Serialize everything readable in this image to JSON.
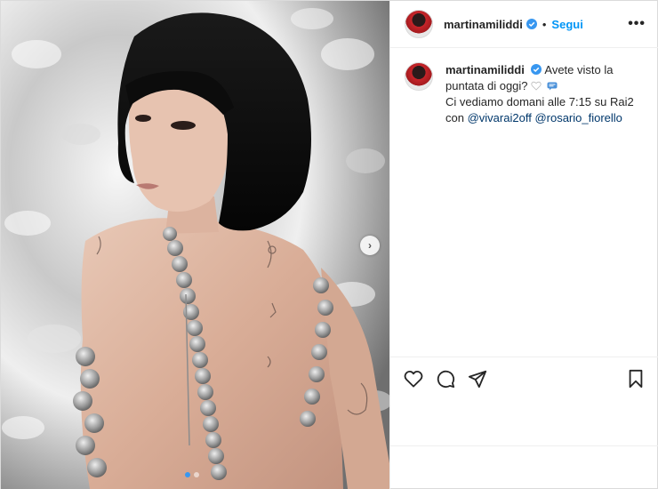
{
  "post": {
    "author": {
      "username": "martinamiliddi",
      "verified": true,
      "follow_label": "Segui",
      "separator": "•"
    },
    "more_options_icon": "more-horizontal-icon",
    "caption": {
      "username": "martinamiliddi",
      "line1": "Avete visto la puntata di oggi?",
      "line2": "Ci vediamo domani alle 7:15 su Rai2 con",
      "mention1": "@vivarai2off",
      "mention2": "@rosario_fiorello",
      "emoji1": "white-heart-icon",
      "emoji2": "speech-bubble-icon"
    },
    "media": {
      "carousel_total": 2,
      "carousel_index": 1,
      "next_icon": "chevron-right-icon"
    },
    "actions": {
      "like_icon": "heart-icon",
      "comment_icon": "comment-icon",
      "share_icon": "send-icon",
      "save_icon": "bookmark-icon"
    },
    "colors": {
      "accent": "#0095f6",
      "mention": "#00376b",
      "verified": "#3897f0",
      "text": "#262626"
    }
  }
}
